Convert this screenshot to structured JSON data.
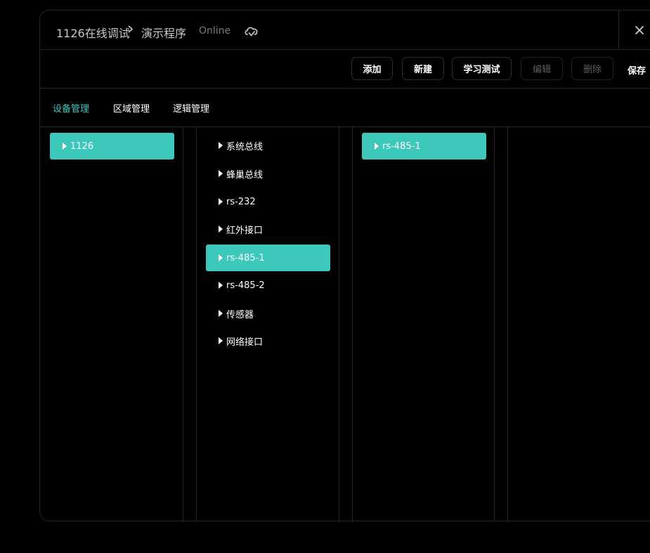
{
  "header": {
    "breadcrumb_root": "1126在线调试",
    "breadcrumb_current": "演示程序",
    "status": "Online"
  },
  "toolbar": {
    "add_label": "添加",
    "new_label": "新建",
    "learn_test_label": "学习测试",
    "edit_label": "编辑",
    "delete_label": "删除",
    "save_label": "保存"
  },
  "tabs": [
    {
      "label": "设备管理",
      "active": true
    },
    {
      "label": "区域管理",
      "active": false
    },
    {
      "label": "逻辑管理",
      "active": false
    }
  ],
  "columns": {
    "devices": [
      {
        "label": "1126",
        "selected": true
      }
    ],
    "interfaces": [
      {
        "label": "系统总线",
        "selected": false
      },
      {
        "label": "蜂巢总线",
        "selected": false
      },
      {
        "label": "rs-232",
        "selected": false
      },
      {
        "label": "红外接口",
        "selected": false
      },
      {
        "label": "rs-485-1",
        "selected": true
      },
      {
        "label": "rs-485-2",
        "selected": false
      },
      {
        "label": "传感器",
        "selected": false
      },
      {
        "label": "网络接口",
        "selected": false
      }
    ],
    "channels": [
      {
        "label": "rs-485-1",
        "selected": true
      }
    ]
  },
  "colors": {
    "accent": "#3cc9bc",
    "background": "#000000",
    "border": "#262626",
    "disabled_text": "#5e5e5e"
  }
}
